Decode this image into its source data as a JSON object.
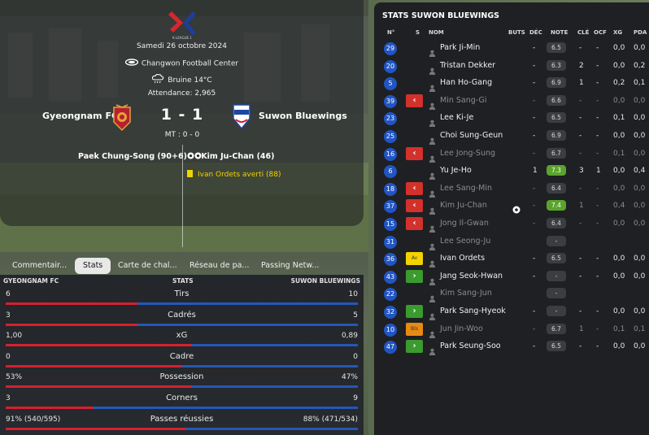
{
  "match": {
    "competition_logo_text": "K LEAGUE 1",
    "date": "Samedi 26 octobre 2024",
    "venue": "Changwon Football Center",
    "weather": "Bruine 14°C",
    "attendance": "Attendance: 2,965",
    "home_team": "Gyeongnam FC",
    "away_team": "Suwon Bluewings",
    "score": "1 - 1",
    "half_time": "MT : 0 - 0",
    "home_goal": "Paek Chung-Song (90+6)",
    "away_goal": "Kim Ju-Chan (46)",
    "away_card": "Ivan Ordets averti (88)"
  },
  "tabs": [
    "Commentair...",
    "Stats",
    "Carte de chal...",
    "Réseau de pa...",
    "Passing Netw..."
  ],
  "active_tab": "Stats",
  "stats_header": {
    "home": "GYEONGNAM FC",
    "mid": "STATS",
    "away": "SUWON BLUEWINGS"
  },
  "stats": [
    {
      "label": "Tirs",
      "home": "6",
      "away": "10",
      "home_share": 0.375
    },
    {
      "label": "Cadrés",
      "home": "3",
      "away": "5",
      "home_share": 0.375
    },
    {
      "label": "xG",
      "home": "1,00",
      "away": "0,89",
      "home_share": 0.53
    },
    {
      "label": "Cadre",
      "home": "0",
      "away": "0",
      "home_share": 0.5
    },
    {
      "label": "Possession",
      "home": "53%",
      "away": "47%",
      "home_share": 0.53
    },
    {
      "label": "Corners",
      "home": "3",
      "away": "9",
      "home_share": 0.25
    },
    {
      "label": "Passes réussies",
      "home": "91% (540/595)",
      "away": "88% (471/534)",
      "home_share": 0.51
    }
  ],
  "players_panel": {
    "title": "STATS SUWON BLUEWINGS",
    "columns": [
      "N°",
      "S",
      "NOM",
      "BUTS",
      "DÉC",
      "NOTE",
      "CLÉ",
      "OCF",
      "XG",
      "PDA"
    ],
    "players": [
      {
        "num": "29",
        "sub": "",
        "name": "Park Ji-Min",
        "dim": false,
        "goals": "",
        "dec": "-",
        "rating": "6.5",
        "green": false,
        "key": "-",
        "ocf": "-",
        "xg": "0,0",
        "pda": "0,0"
      },
      {
        "num": "20",
        "sub": "",
        "name": "Tristan Dekker",
        "dim": false,
        "goals": "",
        "dec": "-",
        "rating": "6.3",
        "green": false,
        "key": "2",
        "ocf": "-",
        "xg": "0,0",
        "pda": "0,2"
      },
      {
        "num": "5",
        "sub": "",
        "name": "Han Ho-Gang",
        "dim": false,
        "goals": "",
        "dec": "-",
        "rating": "6.9",
        "green": false,
        "key": "1",
        "ocf": "-",
        "xg": "0,2",
        "pda": "0,1"
      },
      {
        "num": "39",
        "sub": "out",
        "name": "Min Sang-Gi",
        "dim": true,
        "goals": "",
        "dec": "-",
        "rating": "6.6",
        "green": false,
        "key": "-",
        "ocf": "-",
        "xg": "0,0",
        "pda": "0,0"
      },
      {
        "num": "23",
        "sub": "",
        "name": "Lee Ki-Je",
        "dim": false,
        "goals": "",
        "dec": "-",
        "rating": "6.5",
        "green": false,
        "key": "-",
        "ocf": "-",
        "xg": "0,1",
        "pda": "0,0"
      },
      {
        "num": "25",
        "sub": "",
        "name": "Choi Sung-Geun",
        "dim": false,
        "goals": "",
        "dec": "-",
        "rating": "6.9",
        "green": false,
        "key": "-",
        "ocf": "-",
        "xg": "0,0",
        "pda": "0,0"
      },
      {
        "num": "16",
        "sub": "out",
        "name": "Lee Jong-Sung",
        "dim": true,
        "goals": "",
        "dec": "-",
        "rating": "6.7",
        "green": false,
        "key": "-",
        "ocf": "-",
        "xg": "0,1",
        "pda": "0,0"
      },
      {
        "num": "6",
        "sub": "",
        "name": "Yu Je-Ho",
        "dim": false,
        "goals": "",
        "dec": "1",
        "rating": "7.3",
        "green": true,
        "key": "3",
        "ocf": "1",
        "xg": "0,0",
        "pda": "0,4"
      },
      {
        "num": "18",
        "sub": "out",
        "name": "Lee Sang-Min",
        "dim": true,
        "goals": "",
        "dec": "-",
        "rating": "6.4",
        "green": false,
        "key": "-",
        "ocf": "-",
        "xg": "0,0",
        "pda": "0,0"
      },
      {
        "num": "37",
        "sub": "out",
        "name": "Kim Ju-Chan",
        "dim": true,
        "goals": "ball",
        "dec": "-",
        "rating": "7.4",
        "green": true,
        "key": "1",
        "ocf": "-",
        "xg": "0,4",
        "pda": "0,0"
      },
      {
        "num": "15",
        "sub": "out",
        "name": "Jong Il-Gwan",
        "dim": true,
        "goals": "",
        "dec": "-",
        "rating": "6.4",
        "green": false,
        "key": "-",
        "ocf": "-",
        "xg": "0,0",
        "pda": "0,0"
      },
      {
        "num": "31",
        "sub": "",
        "name": "Lee Seong-Ju",
        "dim": true,
        "goals": "",
        "dec": "",
        "rating": "-",
        "green": false,
        "key": "",
        "ocf": "",
        "xg": "",
        "pda": ""
      },
      {
        "num": "36",
        "sub": "y",
        "sub_text": "Av",
        "name": "Ivan Ordets",
        "dim": false,
        "goals": "",
        "dec": "-",
        "rating": "6.5",
        "green": false,
        "key": "-",
        "ocf": "-",
        "xg": "0,0",
        "pda": "0,0"
      },
      {
        "num": "43",
        "sub": "in",
        "name": "Jang Seok-Hwan",
        "dim": false,
        "goals": "",
        "dec": "-",
        "rating": "-",
        "green": false,
        "key": "-",
        "ocf": "-",
        "xg": "0,0",
        "pda": "0,0"
      },
      {
        "num": "22",
        "sub": "",
        "name": "Kim Sang-Jun",
        "dim": true,
        "goals": "",
        "dec": "",
        "rating": "-",
        "green": false,
        "key": "",
        "ocf": "",
        "xg": "",
        "pda": ""
      },
      {
        "num": "32",
        "sub": "in",
        "name": "Park Sang-Hyeok",
        "dim": false,
        "goals": "",
        "dec": "-",
        "rating": "-",
        "green": false,
        "key": "-",
        "ocf": "-",
        "xg": "0,0",
        "pda": "0,0"
      },
      {
        "num": "10",
        "sub": "o",
        "sub_text": "Bls",
        "name": "Jun Jin-Woo",
        "dim": true,
        "goals": "",
        "dec": "-",
        "rating": "6.7",
        "green": false,
        "key": "1",
        "ocf": "-",
        "xg": "0,1",
        "pda": "0,1"
      },
      {
        "num": "47",
        "sub": "in",
        "name": "Park Seung-Soo",
        "dim": false,
        "goals": "",
        "dec": "-",
        "rating": "6.5",
        "green": false,
        "key": "-",
        "ocf": "-",
        "xg": "0,0",
        "pda": "0,0"
      }
    ]
  },
  "colors": {
    "home_bar": "#d42030",
    "away_bar": "#2557b8",
    "badge_blue": "#2155c4",
    "rating_green": "#5aa42d",
    "sub_out": "#d3312b",
    "sub_in": "#3a9b2f"
  }
}
